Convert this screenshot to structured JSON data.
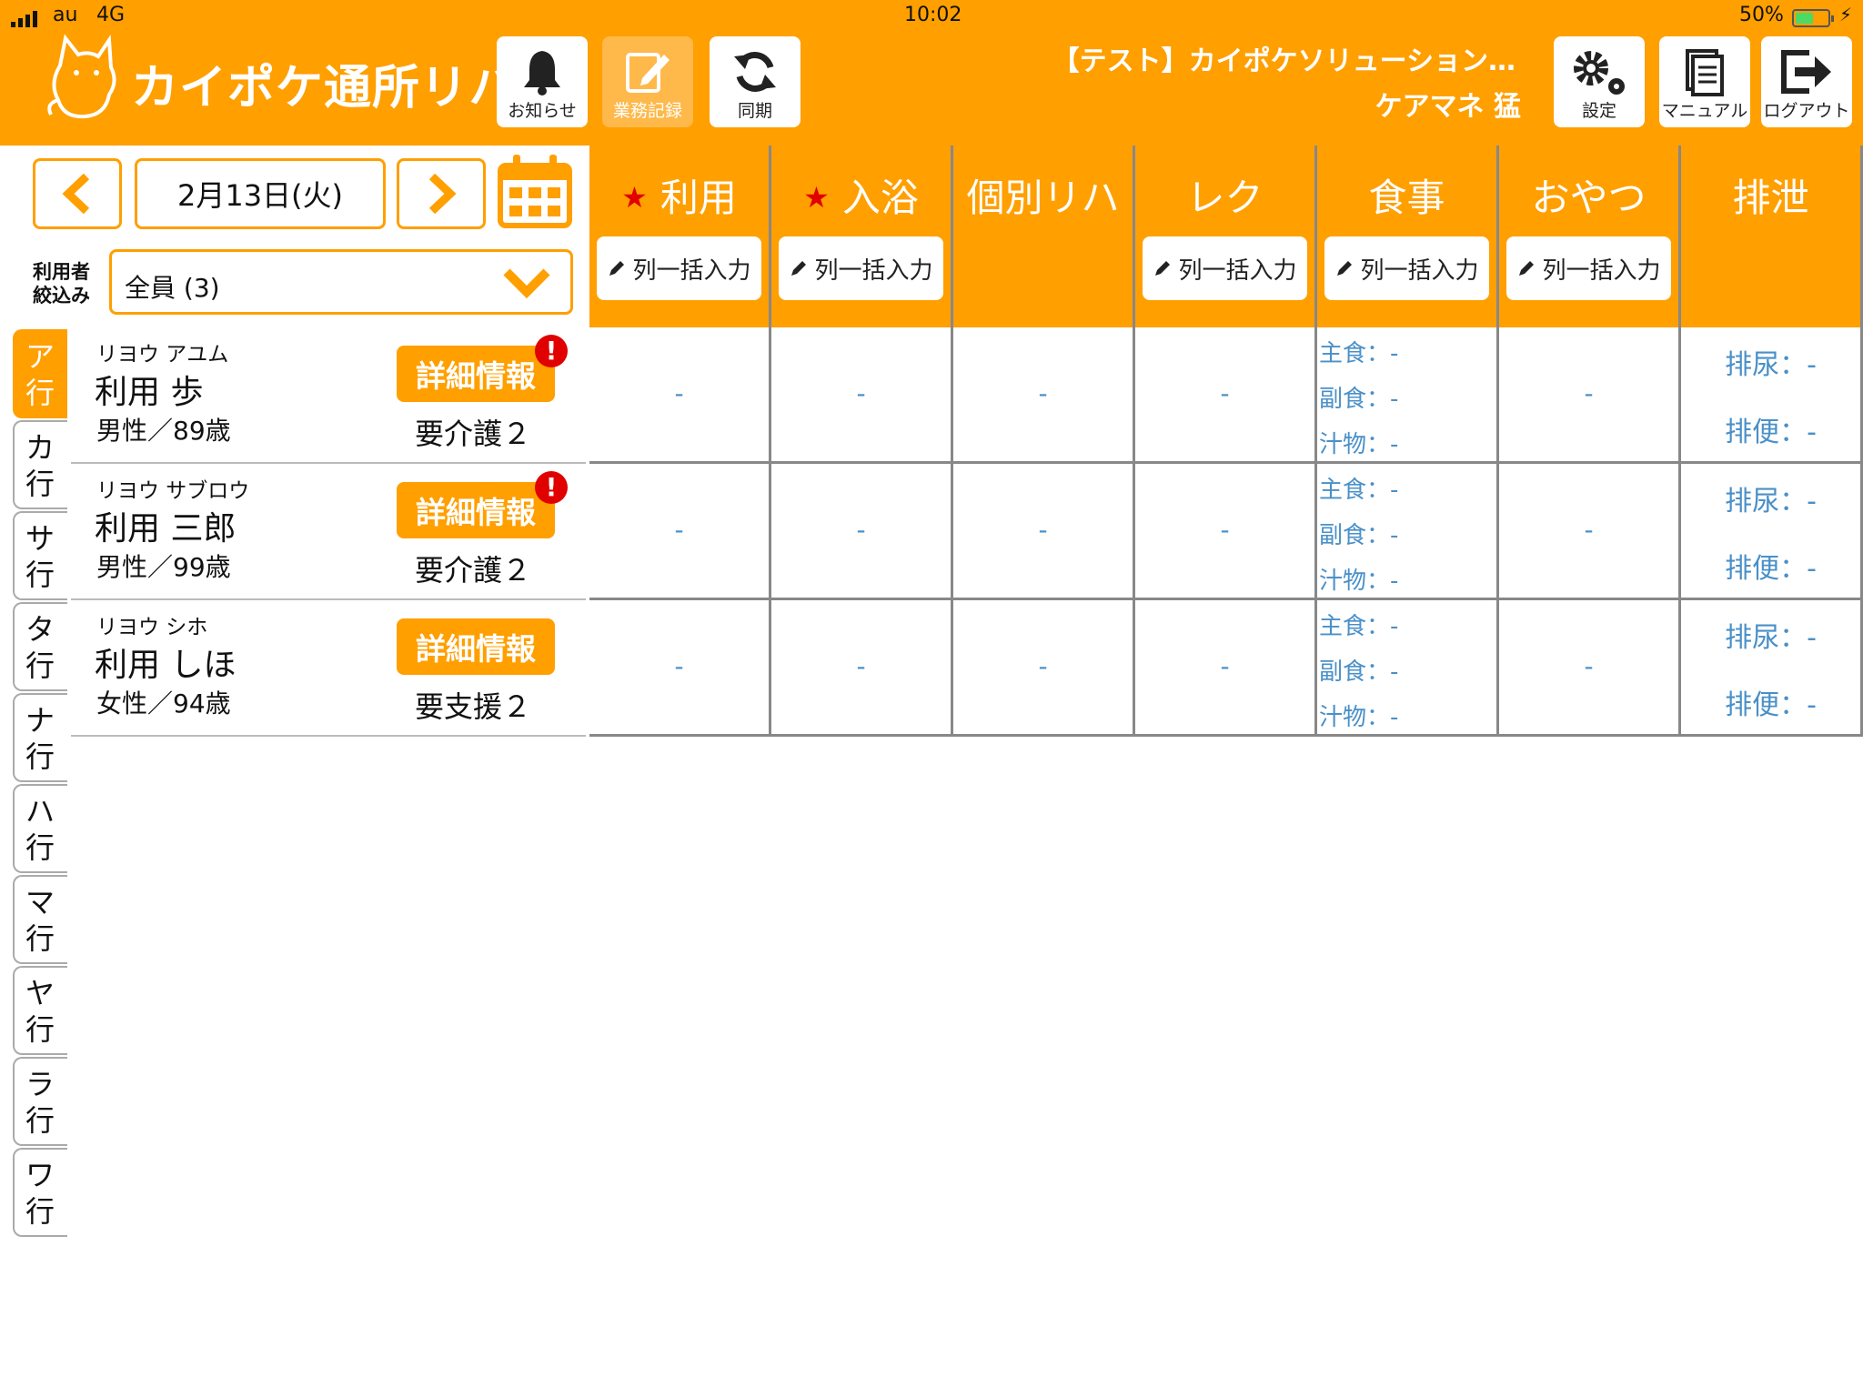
{
  "status_bar": {
    "carrier": "au",
    "network": "4G",
    "time": "10:02",
    "battery": "50%"
  },
  "app": {
    "title": "カイポケ通所リハ",
    "logo_icon": "cat-logo-icon"
  },
  "toolbar": {
    "notice_label": "お知らせ",
    "record_label": "業務記録",
    "sync_label": "同期"
  },
  "account": {
    "facility": "【テスト】カイポケソリューション…",
    "user": "ケアマネ 猛",
    "settings_label": "設定",
    "manual_label": "マニュアル",
    "logout_label": "ログアウト"
  },
  "date_nav": {
    "date": "2月13日(火)"
  },
  "filter": {
    "label": "利用者絞込み",
    "value": "全員 (3)"
  },
  "kana_tabs": [
    "ア行",
    "カ行",
    "サ行",
    "タ行",
    "ナ行",
    "ハ行",
    "マ行",
    "ヤ行",
    "ラ行",
    "ワ行"
  ],
  "active_kana": "ア行",
  "columns": [
    {
      "title": "利用",
      "required": true,
      "bulk": "列一括入力"
    },
    {
      "title": "入浴",
      "required": true,
      "bulk": "列一括入力"
    },
    {
      "title": "個別リハ",
      "required": false,
      "bulk": ""
    },
    {
      "title": "レク",
      "required": false,
      "bulk": "列一括入力"
    },
    {
      "title": "食事",
      "required": false,
      "bulk": "列一括入力"
    },
    {
      "title": "おやつ",
      "required": false,
      "bulk": "列一括入力"
    },
    {
      "title": "排泄",
      "required": false,
      "bulk": ""
    }
  ],
  "patients": [
    {
      "kana": "リヨウ アユム",
      "name": "利用 歩",
      "gender_age": "男性／89歳",
      "detail": "詳細情報",
      "alert": "!",
      "care_level": "要介護２"
    },
    {
      "kana": "リヨウ サブロウ",
      "name": "利用 三郎",
      "gender_age": "男性／99歳",
      "detail": "詳細情報",
      "alert": "!",
      "care_level": "要介護２"
    },
    {
      "kana": "リヨウ シホ",
      "name": "利用 しほ",
      "gender_age": "女性／94歳",
      "detail": "詳細情報",
      "alert": "",
      "care_level": "要支援２"
    }
  ],
  "cells": {
    "empty": "-",
    "meal": [
      "主食：-",
      "副食：-",
      "汁物：-"
    ],
    "excretion": [
      "排尿：-",
      "排便：-"
    ]
  },
  "colors": {
    "brand": "#FF9F00",
    "value_text": "#4a90c8",
    "alert": "#e00000"
  }
}
